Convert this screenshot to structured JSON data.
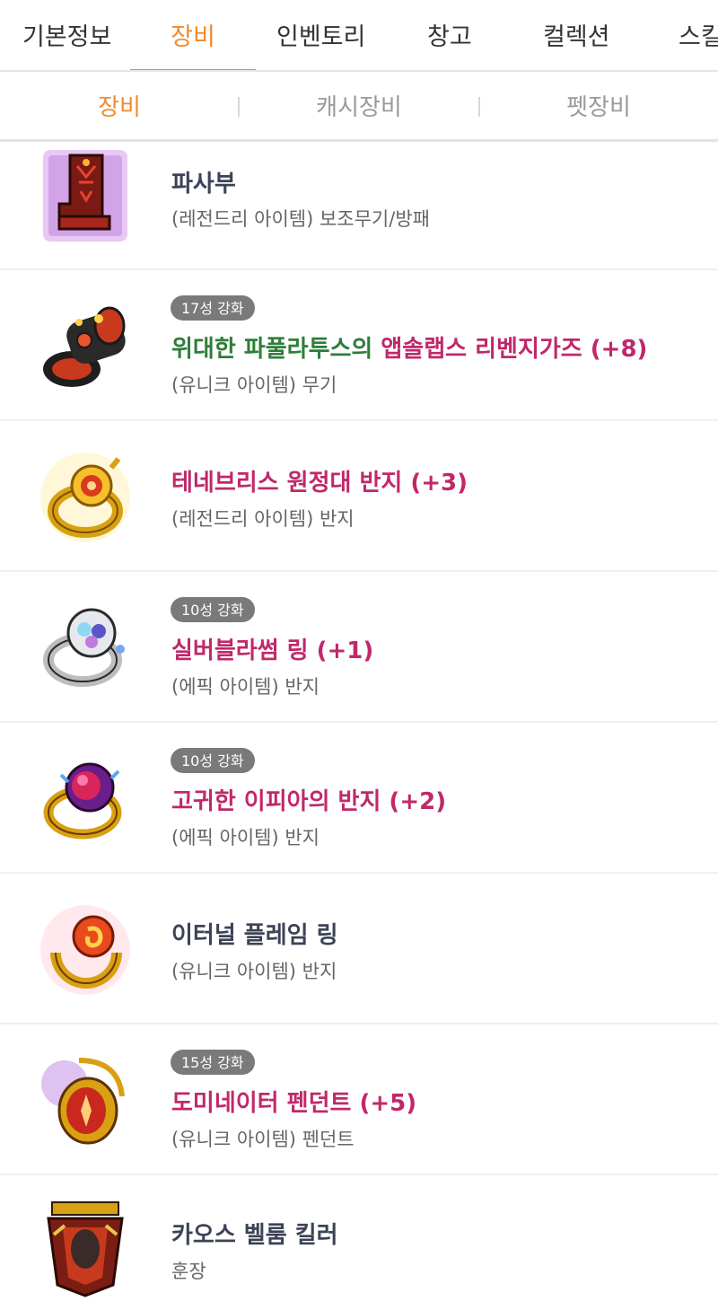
{
  "top_tabs": [
    {
      "label": "기본정보",
      "active": false
    },
    {
      "label": "장비",
      "active": true
    },
    {
      "label": "인벤토리",
      "active": false
    },
    {
      "label": "창고",
      "active": false
    },
    {
      "label": "컬렉션",
      "active": false
    },
    {
      "label": "스킬",
      "active": false
    }
  ],
  "sub_tabs": [
    {
      "label": "장비",
      "active": true
    },
    {
      "label": "캐시장비",
      "active": false
    },
    {
      "label": "펫장비",
      "active": false
    }
  ],
  "colors": {
    "accent": "#f28a2e",
    "item_name_default": "#3c4356",
    "item_name_enhanced": "#c0286a",
    "item_prefix_green": "#2e7d3a",
    "badge_bg": "#7a7a7a"
  },
  "items": [
    {
      "icon": "blue-shield-icon",
      "badge": "",
      "prefix": "",
      "name": "파사부",
      "sub": "(레전드리 아이템) 보조무기/방패"
    },
    {
      "icon": "red-gauntlet-icon",
      "badge": "17성 강화",
      "prefix": "위대한 파풀라투스의 ",
      "name": "앱솔랩스 리벤지가즈 (+8)",
      "sub": "(유니크 아이템) 무기"
    },
    {
      "icon": "gold-ring-icon",
      "badge": "",
      "prefix": "",
      "name": "테네브리스 원정대 반지 (+3)",
      "sub": "(레전드리 아이템) 반지"
    },
    {
      "icon": "silver-ring-icon",
      "badge": "10성 강화",
      "prefix": "",
      "name": "실버블라썸 링 (+1)",
      "sub": "(에픽 아이템) 반지"
    },
    {
      "icon": "rose-ring-icon",
      "badge": "10성 강화",
      "prefix": "",
      "name": "고귀한 이피아의 반지 (+2)",
      "sub": "(에픽 아이템) 반지"
    },
    {
      "icon": "flame-ring-icon",
      "badge": "",
      "prefix": "",
      "name": "이터널 플레임 링",
      "sub": "(유니크 아이템) 반지"
    },
    {
      "icon": "dominator-pendant-icon",
      "badge": "15성 강화",
      "prefix": "",
      "name": "도미네이터 펜던트 (+5)",
      "sub": "(유니크 아이템) 펜던트"
    },
    {
      "icon": "chaos-velum-medal-icon",
      "badge": "",
      "prefix": "",
      "name": "카오스 벨룸 킬러",
      "sub": "훈장"
    }
  ]
}
